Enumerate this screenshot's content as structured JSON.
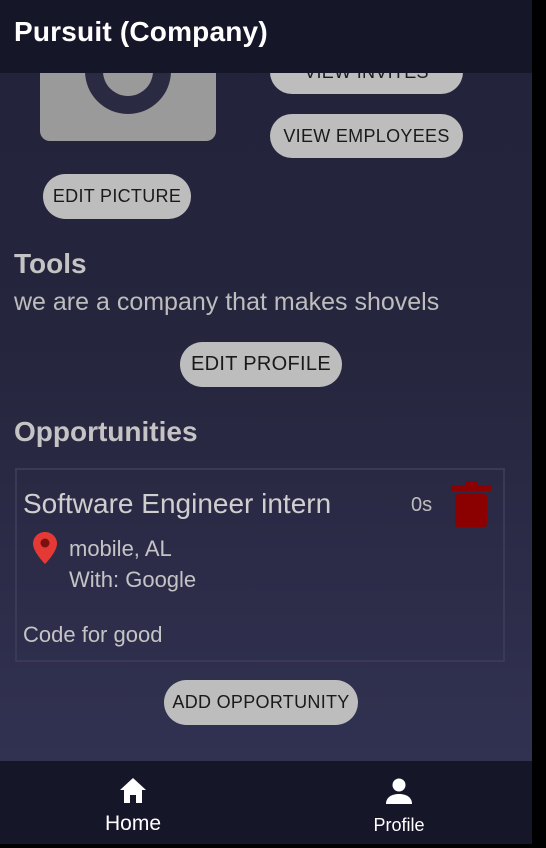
{
  "app_bar": {
    "title": "Pursuit (Company)"
  },
  "profile": {
    "photo_icon": "camera-icon",
    "view_invites_label": "VIEW INVITES",
    "view_employees_label": "VIEW EMPLOYEES",
    "edit_picture_label": "EDIT PICTURE",
    "company_name": "Tools",
    "description": "we are a company that makes shovels",
    "edit_profile_label": "EDIT PROFILE"
  },
  "opportunities": {
    "section_title": "Opportunities",
    "items": [
      {
        "title": "Software Engineer intern",
        "age": "0s",
        "location": "mobile, AL",
        "with": "With: Google",
        "description": "Code for good",
        "delete_icon": "trash-icon",
        "location_icon": "map-pin-icon"
      }
    ],
    "add_label": "ADD OPPORTUNITY"
  },
  "bottom_nav": {
    "items": [
      {
        "label": "Home",
        "icon": "home-icon"
      },
      {
        "label": "Profile",
        "icon": "person-icon"
      }
    ]
  },
  "colors": {
    "app_bar": "#161629",
    "background": "#25253d",
    "button": "#bdbdbd",
    "pin": "#e53935",
    "trash": "#8b0000"
  }
}
